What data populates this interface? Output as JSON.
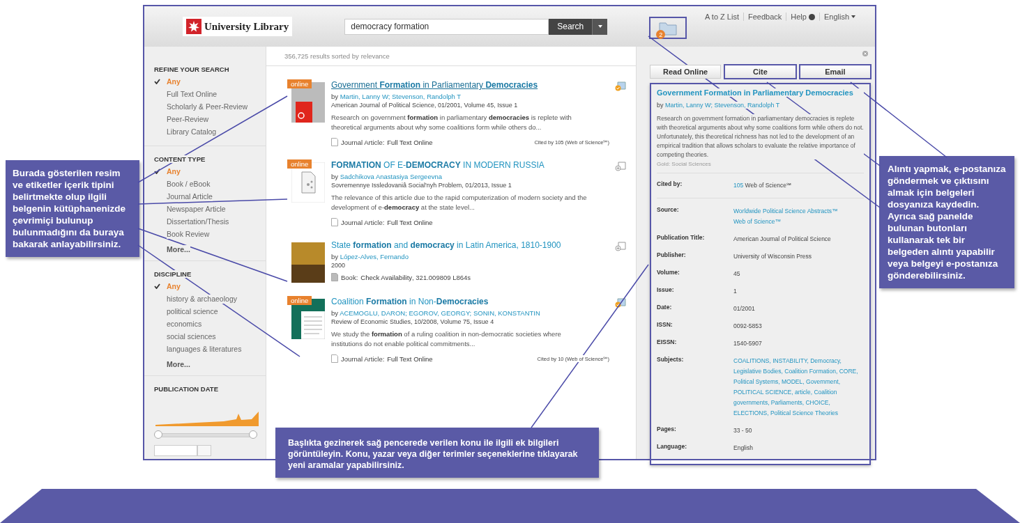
{
  "header": {
    "logo": "University Library",
    "search": {
      "value": "democracy formation",
      "button": "Search"
    },
    "folder": {
      "badge": "2",
      "highlighted": true
    },
    "top_links": [
      "A to Z List",
      "Feedback",
      "Help",
      "English"
    ]
  },
  "sidebar": {
    "sections": [
      {
        "title": "REFINE YOUR SEARCH",
        "items": [
          {
            "label": "Any",
            "selected": true
          },
          {
            "label": "Full Text Online",
            "selected": false
          },
          {
            "label": "Scholarly & Peer-Review",
            "selected": false
          },
          {
            "label": "Peer-Review",
            "selected": false
          },
          {
            "label": "Library Catalog",
            "selected": false
          }
        ]
      },
      {
        "title": "CONTENT TYPE",
        "items": [
          {
            "label": "Any",
            "selected": true
          },
          {
            "label": "Book / eBook",
            "selected": false
          },
          {
            "label": "Journal Article",
            "selected": false
          },
          {
            "label": "Newspaper Article",
            "selected": false
          },
          {
            "label": "Dissertation/Thesis",
            "selected": false
          },
          {
            "label": "Book Review",
            "selected": false
          }
        ],
        "more": "More..."
      },
      {
        "title": "DISCIPLINE",
        "items": [
          {
            "label": "Any",
            "selected": true
          },
          {
            "label": "history & archaeology",
            "selected": false
          },
          {
            "label": "political science",
            "selected": false
          },
          {
            "label": "economics",
            "selected": false
          },
          {
            "label": "social sciences",
            "selected": false
          },
          {
            "label": "languages & literatures",
            "selected": false
          }
        ],
        "more": "More..."
      }
    ],
    "publication_date": {
      "title": "PUBLICATION DATE",
      "range": {
        "level": 1
      }
    }
  },
  "results": {
    "summary": "356,725 results sorted by",
    "sort": "relevance",
    "items": [
      {
        "title": "Government **Formation** in Parliamentary **Democracies**",
        "hovered": true,
        "badge": "online",
        "kind": "journal",
        "by": "by",
        "authors": [
          "Martin, Lanny W;",
          "Stevenson, Randolph T"
        ],
        "source": "American Journal of Political Science, 01/2001, Volume 45, Issue 1",
        "snippet": "Research on government **formation** in parliamentary **democracies** is replete with theoretical arguments about why some coalitions form while others do...",
        "type": "Journal Article:",
        "link": "Full Text Online",
        "cited": "Cited by 105 (Web of Science℠)",
        "saved": true
      },
      {
        "title": "**FORMATION** OF E-**DEMOCRACY** IN MODERN RUSSIA",
        "hovered": false,
        "badge": "online",
        "kind": "article",
        "by": "by",
        "authors": [
          "Sadchikova Anastasiya Sergeevna"
        ],
        "source": "Sovremennye Issledovaniâ Social'nyh Problem, 01/2013, Issue 1",
        "snippet": "The relevance of this article due to the rapid computerization of modern society and the development of e-**democracy** at the state level...",
        "type": "Journal Article:",
        "link": "Full Text Online",
        "saved": false
      },
      {
        "title": "State **formation** and **democracy** in Latin America, 1810-1900",
        "hovered": false,
        "kind": "book",
        "by": "by",
        "authors": [
          "López-Alves, Fernando"
        ],
        "source": "2000",
        "type": "Book:",
        "link": "Check Availability",
        "extra": ", 321.009809 L864s",
        "saved": false
      },
      {
        "title": "Coalition **Formation** in Non-**Democracies**",
        "hovered": false,
        "badge": "online",
        "kind": "review",
        "by": "by",
        "authors": [
          "ACEMOGLU, DARON;",
          "EGOROV, GEORGY;",
          "SONIN, KONSTANTIN"
        ],
        "source": "Review of Economic Studies, 10/2008, Volume 75, Issue 4",
        "snippet": "We study the **formation** of a ruling coalition in non-democratic societies where institutions do not enable political commitments...",
        "type": "Journal Article:",
        "link": "Full Text Online",
        "cited": "Cited by 10 (Web of Science℠)",
        "saved": true
      }
    ]
  },
  "detail": {
    "buttons": [
      {
        "label": "Read Online",
        "highlighted": false
      },
      {
        "label": "Cite",
        "highlighted": true
      },
      {
        "label": "Email",
        "highlighted": true
      }
    ],
    "highlighted": true,
    "title": "Government Formation in Parliamentary Democracies",
    "by": "by",
    "authors": [
      "Martin, Lanny W;",
      "Stevenson, Randolph T"
    ],
    "abstract": "Research on government formation in parliamentary democracies is replete with theoretical arguments about why some coalitions form while others do not. Unfortunately, this theoretical richness has not led to the development of an empirical tradition that allows scholars to evaluate the relative importance of competing theories.",
    "discipline": "Gold: Social Sciences",
    "fields": [
      {
        "label": "Cited by:",
        "lines": [
          [
            {
              "text": "105",
              "link": true
            },
            {
              "text": "Web of Science℠",
              "link": false
            }
          ]
        ]
      },
      {
        "label": "Source:",
        "lines": [
          [
            {
              "text": "Worldwide Political Science Abstracts™",
              "link": true
            }
          ],
          [
            {
              "text": "Web of Science™",
              "link": true
            }
          ]
        ]
      },
      {
        "label": "Publication Title:",
        "lines": [
          [
            {
              "text": "American Journal of Political Science",
              "link": false
            }
          ]
        ]
      },
      {
        "label": "Publisher:",
        "lines": [
          [
            {
              "text": "University of Wisconsin Press",
              "link": false
            }
          ]
        ]
      },
      {
        "label": "Volume:",
        "lines": [
          [
            {
              "text": "45",
              "link": false
            }
          ]
        ]
      },
      {
        "label": "Issue:",
        "lines": [
          [
            {
              "text": "1",
              "link": false
            }
          ]
        ]
      },
      {
        "label": "Date:",
        "lines": [
          [
            {
              "text": "01/2001",
              "link": false
            }
          ]
        ]
      },
      {
        "label": "ISSN:",
        "lines": [
          [
            {
              "text": "0092-5853",
              "link": false
            }
          ]
        ]
      },
      {
        "label": "EISSN:",
        "lines": [
          [
            {
              "text": "1540-5907",
              "link": false
            }
          ]
        ]
      },
      {
        "label": "Subjects:",
        "lines": [
          [
            {
              "text": "COALITIONS, INSTABILITY, Democracy, Legislative Bodies, Coalition Formation, CORE, Political Systems, MODEL, Government, POLITICAL SCIENCE, article, Coalition governments, Parliaments, CHOICE, ELECTIONS, Political Science Theories",
              "link": true
            }
          ]
        ]
      },
      {
        "label": "Pages:",
        "lines": [
          [
            {
              "text": "33 - 50",
              "link": false
            }
          ]
        ]
      },
      {
        "label": "Language:",
        "lines": [
          [
            {
              "text": "English",
              "link": false
            }
          ]
        ]
      }
    ]
  },
  "callouts": [
    {
      "text": "Burada gösterilen resim ve etiketler içerik tipini belirtmekte olup ilgili belgenin kütüphanenizde çevrimiçi bulunup bulunmadığını da buraya bakarak anlayabilirsiniz."
    },
    {
      "text": "Alıntı yapmak, e-postanıza göndermek ve çıktısını almak için belgeleri dosyanıza kaydedin. Ayrıca sağ panelde bulunan butonları kullanarak tek bir belgeden alıntı yapabilir veya belgeyi e-postanıza gönderebilirsiniz."
    },
    {
      "text": "Başlıkta gezinerek sağ pencerede verilen konu ile ilgili ek bilgileri görüntüleyin. Konu, yazar veya diğer terimler seçeneklerine tıklayarak yeni aramalar yapabilirsiniz."
    }
  ]
}
